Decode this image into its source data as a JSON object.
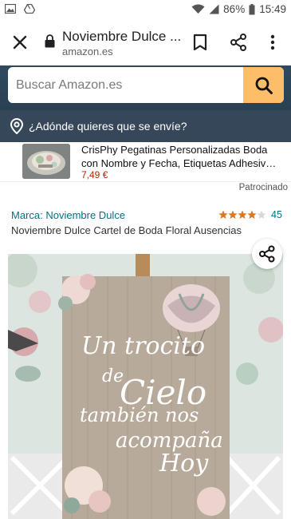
{
  "status_bar": {
    "battery": "86%",
    "time": "15:49",
    "icons": [
      "gallery-icon",
      "drive-icon",
      "wifi-icon",
      "signal-icon",
      "battery-icon"
    ]
  },
  "browser": {
    "page_title": "Noviembre Dulce ...",
    "url": "amazon.es",
    "icons": [
      "close-icon",
      "lock-icon",
      "bookmark-icon",
      "share-icon",
      "more-vert-icon"
    ]
  },
  "header": {
    "search_placeholder": "Buscar Amazon.es",
    "deliver_text": "¿Adónde quieres que se envíe?",
    "colors": {
      "header_bg": "#2f4a5e",
      "search_button": "#febd69"
    }
  },
  "sponsored_ad": {
    "title": "CrisPhy Pegatinas Personalizadas Boda con Nombre y Fecha, Etiquetas Adhesiv…",
    "price": "7,49 €",
    "label": "Patrocinado"
  },
  "product": {
    "brand": "Marca: Noviembre Dulce",
    "rating": 4.5,
    "rating_count": "45",
    "title": "Noviembre Dulce Cartel de Boda Floral Ausencias",
    "sign_lines": [
      "Un trocito",
      "de",
      "Cielo",
      "también nos",
      "acompaña",
      "Hoy"
    ]
  }
}
